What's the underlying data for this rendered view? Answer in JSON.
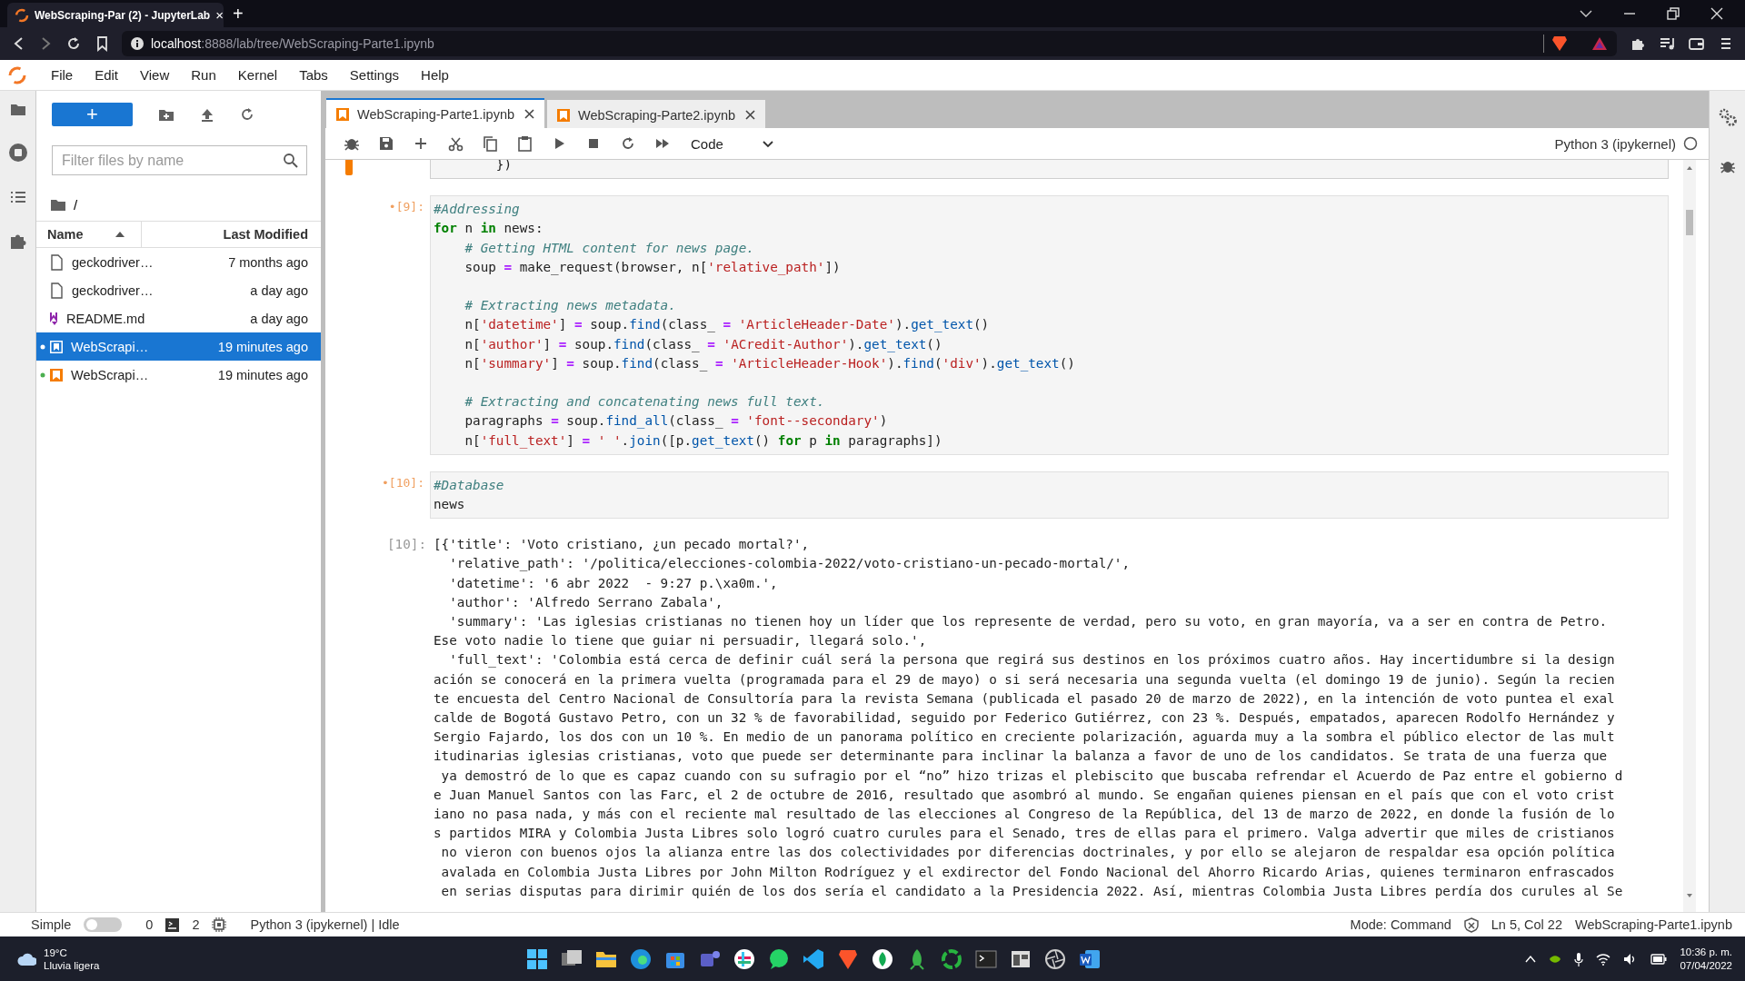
{
  "browser": {
    "tab": {
      "title": "WebScraping-Par (2) - JupyterLab",
      "close": "×"
    },
    "new_tab": "+",
    "url": {
      "host": "localhost",
      "path": ":8888/lab/tree/WebScraping-Parte1.ipynb"
    }
  },
  "menu": [
    "File",
    "Edit",
    "View",
    "Run",
    "Kernel",
    "Tabs",
    "Settings",
    "Help"
  ],
  "file_browser": {
    "new_button": "+",
    "filter": {
      "placeholder": "Filter files by name"
    },
    "path": "/",
    "columns": [
      {
        "label": "Name",
        "sorted": true
      },
      {
        "label": "Last Modified",
        "sorted": false
      }
    ],
    "files": [
      {
        "name": "geckodriver…",
        "modified": "7 months ago",
        "kind": "file",
        "selected": false,
        "running": false
      },
      {
        "name": "geckodriver…",
        "modified": "a day ago",
        "kind": "file",
        "selected": false,
        "running": false
      },
      {
        "name": "README.md",
        "modified": "a day ago",
        "kind": "markdown",
        "selected": false,
        "running": false
      },
      {
        "name": "WebScrapi…",
        "modified": "19 minutes ago",
        "kind": "notebook",
        "selected": true,
        "running": true
      },
      {
        "name": "WebScrapi…",
        "modified": "19 minutes ago",
        "kind": "notebook",
        "selected": false,
        "running": true
      }
    ]
  },
  "notebook_tabs": [
    {
      "label": "WebScraping-Parte1.ipynb",
      "selected": true
    },
    {
      "label": "WebScraping-Parte2.ipynb",
      "selected": false
    }
  ],
  "toolbar": {
    "cell_type": "Code",
    "kernel": "Python 3 (ipykernel)",
    "kernel_busy": false
  },
  "cells": [
    {
      "kind": "code",
      "active": true,
      "blocks": [
        [
          [
            {
              "kind": "plain",
              "text": "        })"
            }
          ]
        ]
      ]
    },
    {
      "kind": "code",
      "active": false,
      "prompt": "•[9]:",
      "blocks": [
        [
          [
            {
              "kind": "comment",
              "text": "#Addressing"
            }
          ],
          [
            {
              "kind": "keyword",
              "text": "for"
            },
            {
              "kind": "plain",
              "text": " n "
            },
            {
              "kind": "keyword",
              "text": "in"
            },
            {
              "kind": "plain",
              "text": " news:"
            }
          ],
          [
            {
              "kind": "comment",
              "text": "    # Getting HTML content for news page."
            }
          ],
          [
            {
              "kind": "plain",
              "text": "    soup "
            },
            {
              "kind": "operator",
              "text": "="
            },
            {
              "kind": "plain",
              "text": " make_request(browser, n["
            },
            {
              "kind": "string",
              "text": "'relative_path'"
            },
            {
              "kind": "plain",
              "text": "])"
            }
          ]
        ],
        [
          [
            {
              "kind": "comment",
              "text": "    # Extracting news metadata."
            }
          ],
          [
            {
              "kind": "plain",
              "text": "    n["
            },
            {
              "kind": "string",
              "text": "'datetime'"
            },
            {
              "kind": "plain",
              "text": "] "
            },
            {
              "kind": "operator",
              "text": "="
            },
            {
              "kind": "plain",
              "text": " soup."
            },
            {
              "kind": "function",
              "text": "find"
            },
            {
              "kind": "plain",
              "text": "(class_ "
            },
            {
              "kind": "operator",
              "text": "="
            },
            {
              "kind": "string",
              "text": " 'ArticleHeader-Date'"
            },
            {
              "kind": "plain",
              "text": ")."
            },
            {
              "kind": "function",
              "text": "get_text"
            },
            {
              "kind": "plain",
              "text": "()"
            }
          ],
          [
            {
              "kind": "plain",
              "text": "    n["
            },
            {
              "kind": "string",
              "text": "'author'"
            },
            {
              "kind": "plain",
              "text": "] "
            },
            {
              "kind": "operator",
              "text": "="
            },
            {
              "kind": "plain",
              "text": " soup."
            },
            {
              "kind": "function",
              "text": "find"
            },
            {
              "kind": "plain",
              "text": "(class_ "
            },
            {
              "kind": "operator",
              "text": "="
            },
            {
              "kind": "string",
              "text": " 'ACredit-Author'"
            },
            {
              "kind": "plain",
              "text": ")."
            },
            {
              "kind": "function",
              "text": "get_text"
            },
            {
              "kind": "plain",
              "text": "()"
            }
          ],
          [
            {
              "kind": "plain",
              "text": "    n["
            },
            {
              "kind": "string",
              "text": "'summary'"
            },
            {
              "kind": "plain",
              "text": "] "
            },
            {
              "kind": "operator",
              "text": "="
            },
            {
              "kind": "plain",
              "text": " soup."
            },
            {
              "kind": "function",
              "text": "find"
            },
            {
              "kind": "plain",
              "text": "(class_ "
            },
            {
              "kind": "operator",
              "text": "="
            },
            {
              "kind": "string",
              "text": " 'ArticleHeader-Hook'"
            },
            {
              "kind": "plain",
              "text": ")."
            },
            {
              "kind": "function",
              "text": "find"
            },
            {
              "kind": "plain",
              "text": "("
            },
            {
              "kind": "string",
              "text": "'div'"
            },
            {
              "kind": "plain",
              "text": ")."
            },
            {
              "kind": "function",
              "text": "get_text"
            },
            {
              "kind": "plain",
              "text": "()"
            }
          ]
        ],
        [
          [
            {
              "kind": "comment",
              "text": "    # Extracting and concatenating news full text."
            }
          ],
          [
            {
              "kind": "plain",
              "text": "    paragraphs "
            },
            {
              "kind": "operator",
              "text": "="
            },
            {
              "kind": "plain",
              "text": " soup."
            },
            {
              "kind": "function",
              "text": "find_all"
            },
            {
              "kind": "plain",
              "text": "(class_ "
            },
            {
              "kind": "operator",
              "text": "="
            },
            {
              "kind": "string",
              "text": " 'font--secondary'"
            },
            {
              "kind": "plain",
              "text": ")"
            }
          ],
          [
            {
              "kind": "plain",
              "text": "    n["
            },
            {
              "kind": "string",
              "text": "'full_text'"
            },
            {
              "kind": "plain",
              "text": "] "
            },
            {
              "kind": "operator",
              "text": "="
            },
            {
              "kind": "string",
              "text": " ' '"
            },
            {
              "kind": "plain",
              "text": "."
            },
            {
              "kind": "function",
              "text": "join"
            },
            {
              "kind": "plain",
              "text": "([p."
            },
            {
              "kind": "function",
              "text": "get_text"
            },
            {
              "kind": "plain",
              "text": "() "
            },
            {
              "kind": "keyword",
              "text": "for"
            },
            {
              "kind": "plain",
              "text": " p "
            },
            {
              "kind": "keyword",
              "text": "in"
            },
            {
              "kind": "plain",
              "text": " paragraphs])"
            }
          ]
        ]
      ]
    },
    {
      "kind": "code",
      "active": false,
      "prompt": "•[10]:",
      "blocks": [
        [
          [
            {
              "kind": "comment",
              "text": "#Database"
            }
          ],
          [
            {
              "kind": "plain",
              "text": "news"
            }
          ]
        ]
      ]
    },
    {
      "kind": "output",
      "prompt": "[10]:",
      "lines": [
        "[{'title': 'Voto cristiano, ¿un pecado mortal?',",
        "  'relative_path': '/politica/elecciones-colombia-2022/voto-cristiano-un-pecado-mortal/',",
        "  'datetime': '6 abr 2022  - 9:27 p.\\xa0m.',",
        "  'author': 'Alfredo Serrano Zabala',",
        "  'summary': 'Las iglesias cristianas no tienen hoy un líder que los represente de verdad, pero su voto, en gran mayoría, va a ser en contra de Petro.",
        "Ese voto nadie lo tiene que guiar ni persuadir, llegará solo.',",
        "  'full_text': 'Colombia está cerca de definir cuál será la persona que regirá sus destinos en los próximos cuatro años. Hay incertidumbre si la design",
        "ación se conocerá en la primera vuelta (programada para el 29 de mayo) o si será necesaria una segunda vuelta (el domingo 19 de junio). Según la recien",
        "te encuesta del Centro Nacional de Consultoría para la revista Semana (publicada el pasado 20 de marzo de 2022), en la intención de voto puntea el exal",
        "calde de Bogotá Gustavo Petro, con un 32 % de favorabilidad, seguido por Federico Gutiérrez, con 23 %. Después, empatados, aparecen Rodolfo Hernández y",
        "Sergio Fajardo, los dos con un 10 %. En medio de un panorama político en creciente polarización, aguarda muy a la sombra el público elector de las mult",
        "itudinarias iglesias cristianas, voto que puede ser determinante para inclinar la balanza a favor de uno de los candidatos. Se trata de una fuerza que",
        " ya demostró de lo que es capaz cuando con su sufragio por el “no” hizo trizas el plebiscito que buscaba refrendar el Acuerdo de Paz entre el gobierno d",
        "e Juan Manuel Santos con las Farc, el 2 de octubre de 2016, resultado que asombró al mundo. Se engañan quienes piensan en el país que con el voto crist",
        "iano no pasa nada, y más con el reciente mal resultado de las elecciones al Congreso de la República, del 13 de marzo de 2022, en donde la fusión de lo",
        "s partidos MIRA y Colombia Justa Libres solo logró cuatro curules para el Senado, tres de ellas para el primero. Valga advertir que miles de cristianos",
        " no vieron con buenos ojos la alianza entre las dos colectividades por diferencias doctrinales, y por ello se alejaron de respaldar esa opción política",
        " avalada en Colombia Justa Libres por John Milton Rodríguez y el exdirector del Fondo Nacional del Ahorro Ricardo Arias, quienes terminaron enfrascados",
        " en serias disputas para dirimir quién de los dos sería el candidato a la Presidencia 2022. Así, mientras Colombia Justa Libres perdía dos curules al Se"
      ]
    }
  ],
  "status_bar": {
    "simple_mode": {
      "label": "Simple",
      "on": false
    },
    "terminals": "0",
    "kernels": "2",
    "kernel_status": "Python 3 (ipykernel) | Idle",
    "mode": "Mode: Command",
    "cursor": "Ln 5, Col 22",
    "file": "WebScraping-Parte1.ipynb"
  },
  "taskbar": {
    "weather": {
      "temp": "19°C",
      "desc": "Lluvia ligera"
    },
    "clock": {
      "time": "10:36 p. m.",
      "date": "07/04/2022"
    }
  }
}
